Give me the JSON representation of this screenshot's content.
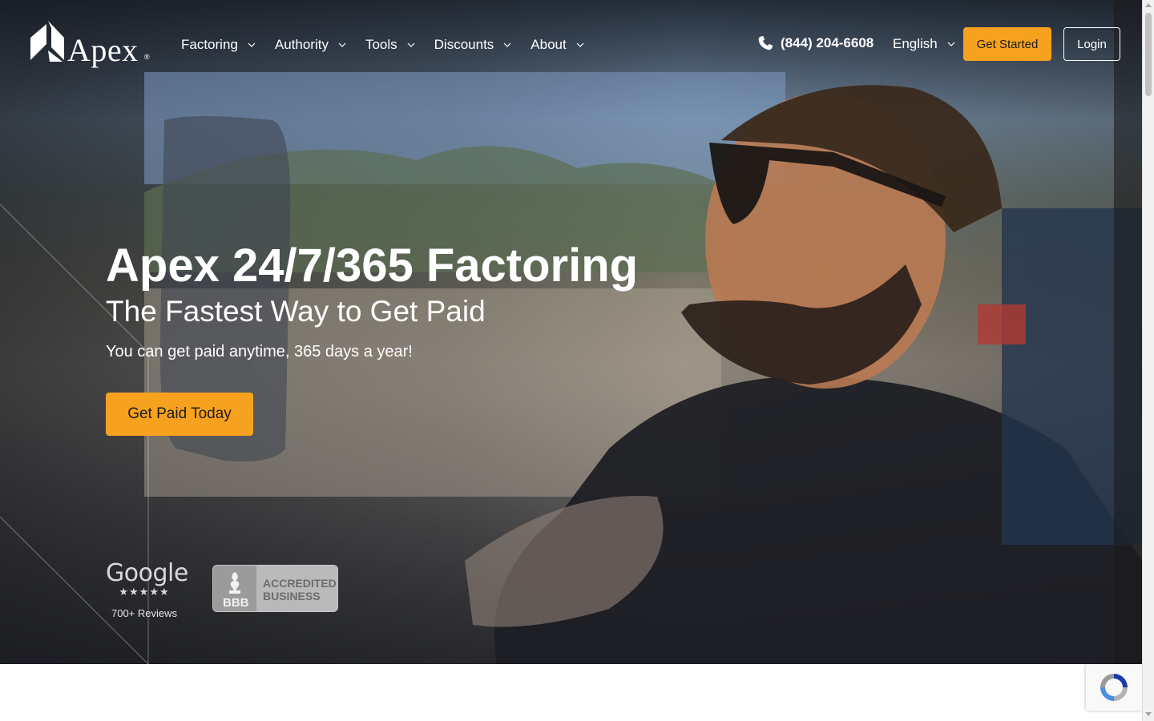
{
  "brand": {
    "name": "Apex",
    "registered_mark": "®"
  },
  "nav": {
    "menu": [
      {
        "label": "Factoring"
      },
      {
        "label": "Authority"
      },
      {
        "label": "Tools"
      },
      {
        "label": "Discounts"
      },
      {
        "label": "About"
      }
    ],
    "phone": "(844) 204-6608",
    "language": "English",
    "get_started_label": "Get Started",
    "login_label": "Login"
  },
  "hero": {
    "title": "Apex 24/7/365 Factoring",
    "subtitle": "The Fastest Way to Get Paid",
    "text": "You can get paid anytime, 365 days a year!",
    "cta_label": "Get Paid Today"
  },
  "trust": {
    "google_word": "Google",
    "google_stars": "★★★★★",
    "google_reviews": "700+ Reviews",
    "bbb_label": "BBB",
    "bbb_line1": "ACCREDITED",
    "bbb_line2": "BUSINESS"
  },
  "colors": {
    "accent": "#f7a21e",
    "text_light": "#ffffff"
  },
  "icons": [
    "phone-icon",
    "chevron-down-icon",
    "apex-logo-icon",
    "bbb-torch-icon",
    "recaptcha-icon"
  ]
}
